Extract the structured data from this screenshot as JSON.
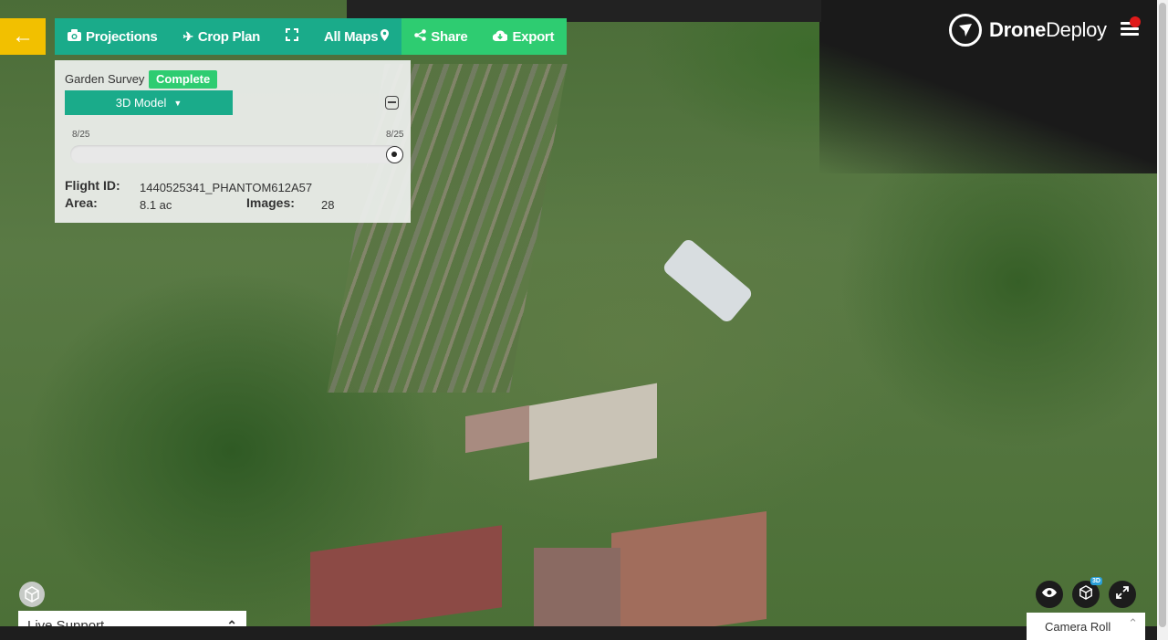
{
  "toolbar": {
    "back_icon": "arrow-left-icon",
    "projections": "Projections",
    "crop_plan": "Crop Plan",
    "all_maps": "All Maps",
    "share": "Share",
    "export": "Export"
  },
  "brand": {
    "bold": "Drone",
    "light": "Deploy"
  },
  "panel": {
    "survey_name": "Garden Survey",
    "status": "Complete",
    "model_select": "3D Model",
    "date_start": "8/25",
    "date_end": "8/25",
    "flight_id_label": "Flight ID:",
    "flight_id_value": "1440525341_PHANTOM612A57",
    "area_label": "Area:",
    "area_value": "8.1 ac",
    "images_label": "Images:",
    "images_value": "28"
  },
  "live_support": {
    "label": "Live Support"
  },
  "viewer": {
    "badge_3d": "3D"
  },
  "camera_roll": {
    "label": "Camera Roll"
  },
  "colors": {
    "accent": "#1aab8a",
    "share": "#2ecc71",
    "back": "#f2c000",
    "notification": "#e01a1a"
  }
}
